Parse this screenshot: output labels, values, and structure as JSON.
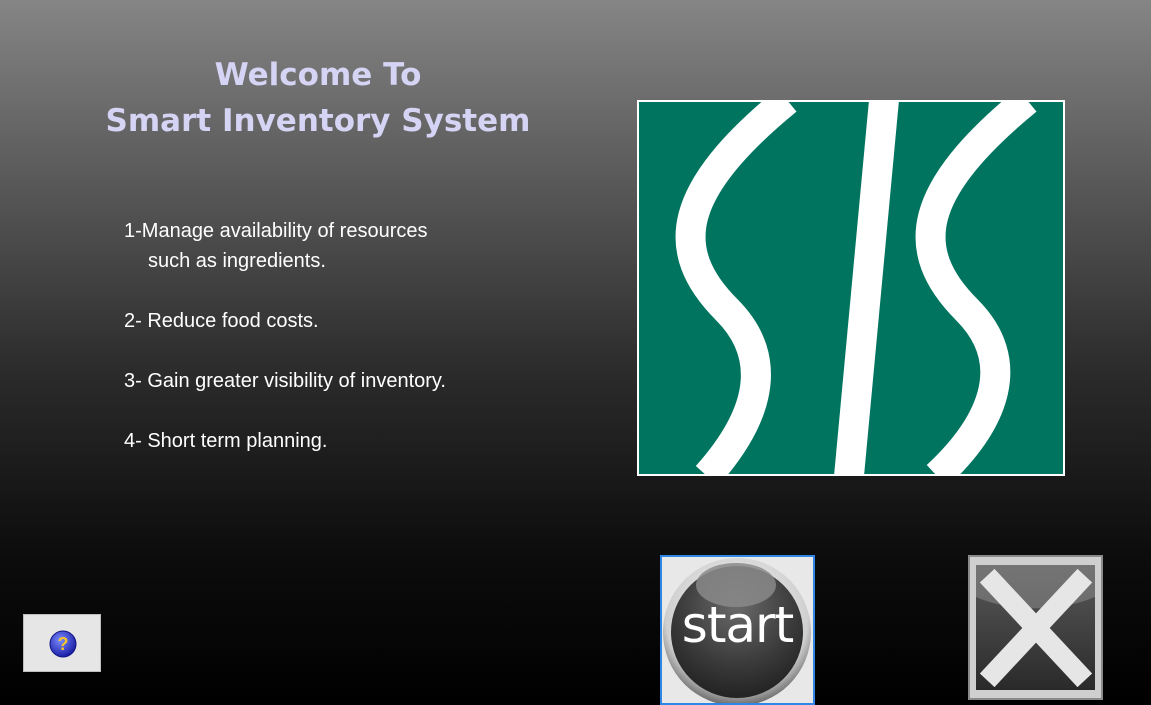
{
  "welcome": {
    "line1": "Welcome To",
    "line2": "Smart Inventory System"
  },
  "features": [
    {
      "main": "1-Manage availability of resources",
      "sub": "such as ingredients."
    },
    {
      "main": "2- Reduce food costs."
    },
    {
      "main": "3- Gain greater visibility of inventory."
    },
    {
      "main": "4- Short term planning."
    }
  ],
  "logo": {
    "brand_color": "#00745f",
    "stripe_color": "#ffffff"
  },
  "buttons": {
    "help_icon": "question-icon",
    "start_label": "start",
    "close_icon": "close-icon"
  },
  "colors": {
    "title": "#d6d4f4",
    "start_border": "#2f86e6"
  }
}
